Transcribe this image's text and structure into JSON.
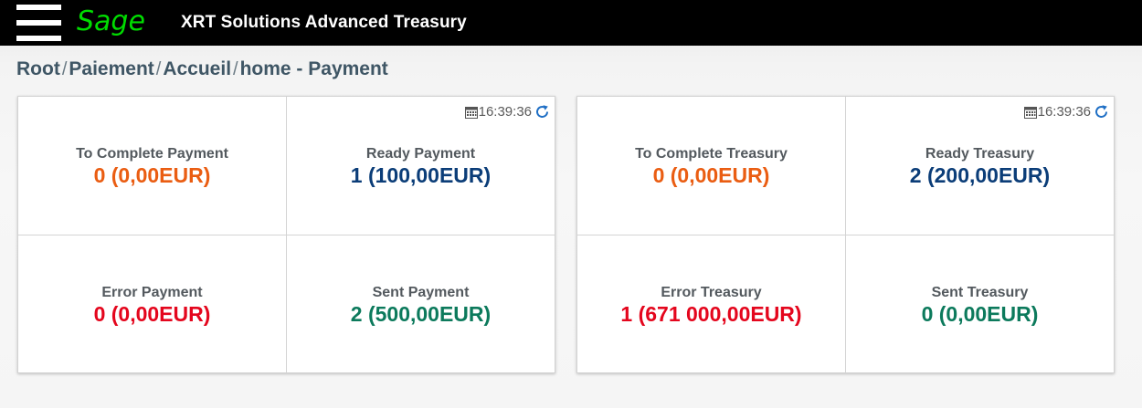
{
  "header": {
    "logo_text": "Sage",
    "app_title": "XRT Solutions Advanced Treasury",
    "logo_color": "#00dc00"
  },
  "breadcrumb": {
    "items": [
      "Root",
      "Paiement",
      "Accueil",
      "home - Payment"
    ],
    "separator": "/"
  },
  "payment_panel": {
    "timestamp": "16:39:36",
    "cells": [
      {
        "title": "To Complete Payment",
        "value": "0 (0,00EUR)",
        "color": "#ea5d12"
      },
      {
        "title": "Ready Payment",
        "value": "1 (100,00EUR)",
        "color": "#0b3d78"
      },
      {
        "title": "Error Payment",
        "value": "0 (0,00EUR)",
        "color": "#e4061d"
      },
      {
        "title": "Sent Payment",
        "value": "2 (500,00EUR)",
        "color": "#0c7a5c"
      }
    ]
  },
  "treasury_panel": {
    "timestamp": "16:39:36",
    "cells": [
      {
        "title": "To Complete Treasury",
        "value": "0 (0,00EUR)",
        "color": "#ea5d12"
      },
      {
        "title": "Ready Treasury",
        "value": "2 (200,00EUR)",
        "color": "#0b3d78"
      },
      {
        "title": "Error Treasury",
        "value": "1 (671 000,00EUR)",
        "color": "#e4061d"
      },
      {
        "title": "Sent Treasury",
        "value": "0 (0,00EUR)",
        "color": "#0c7a5c"
      }
    ]
  },
  "icons": {
    "menu": "hamburger-menu-icon",
    "calendar": "calendar-icon",
    "refresh": "refresh-icon"
  }
}
